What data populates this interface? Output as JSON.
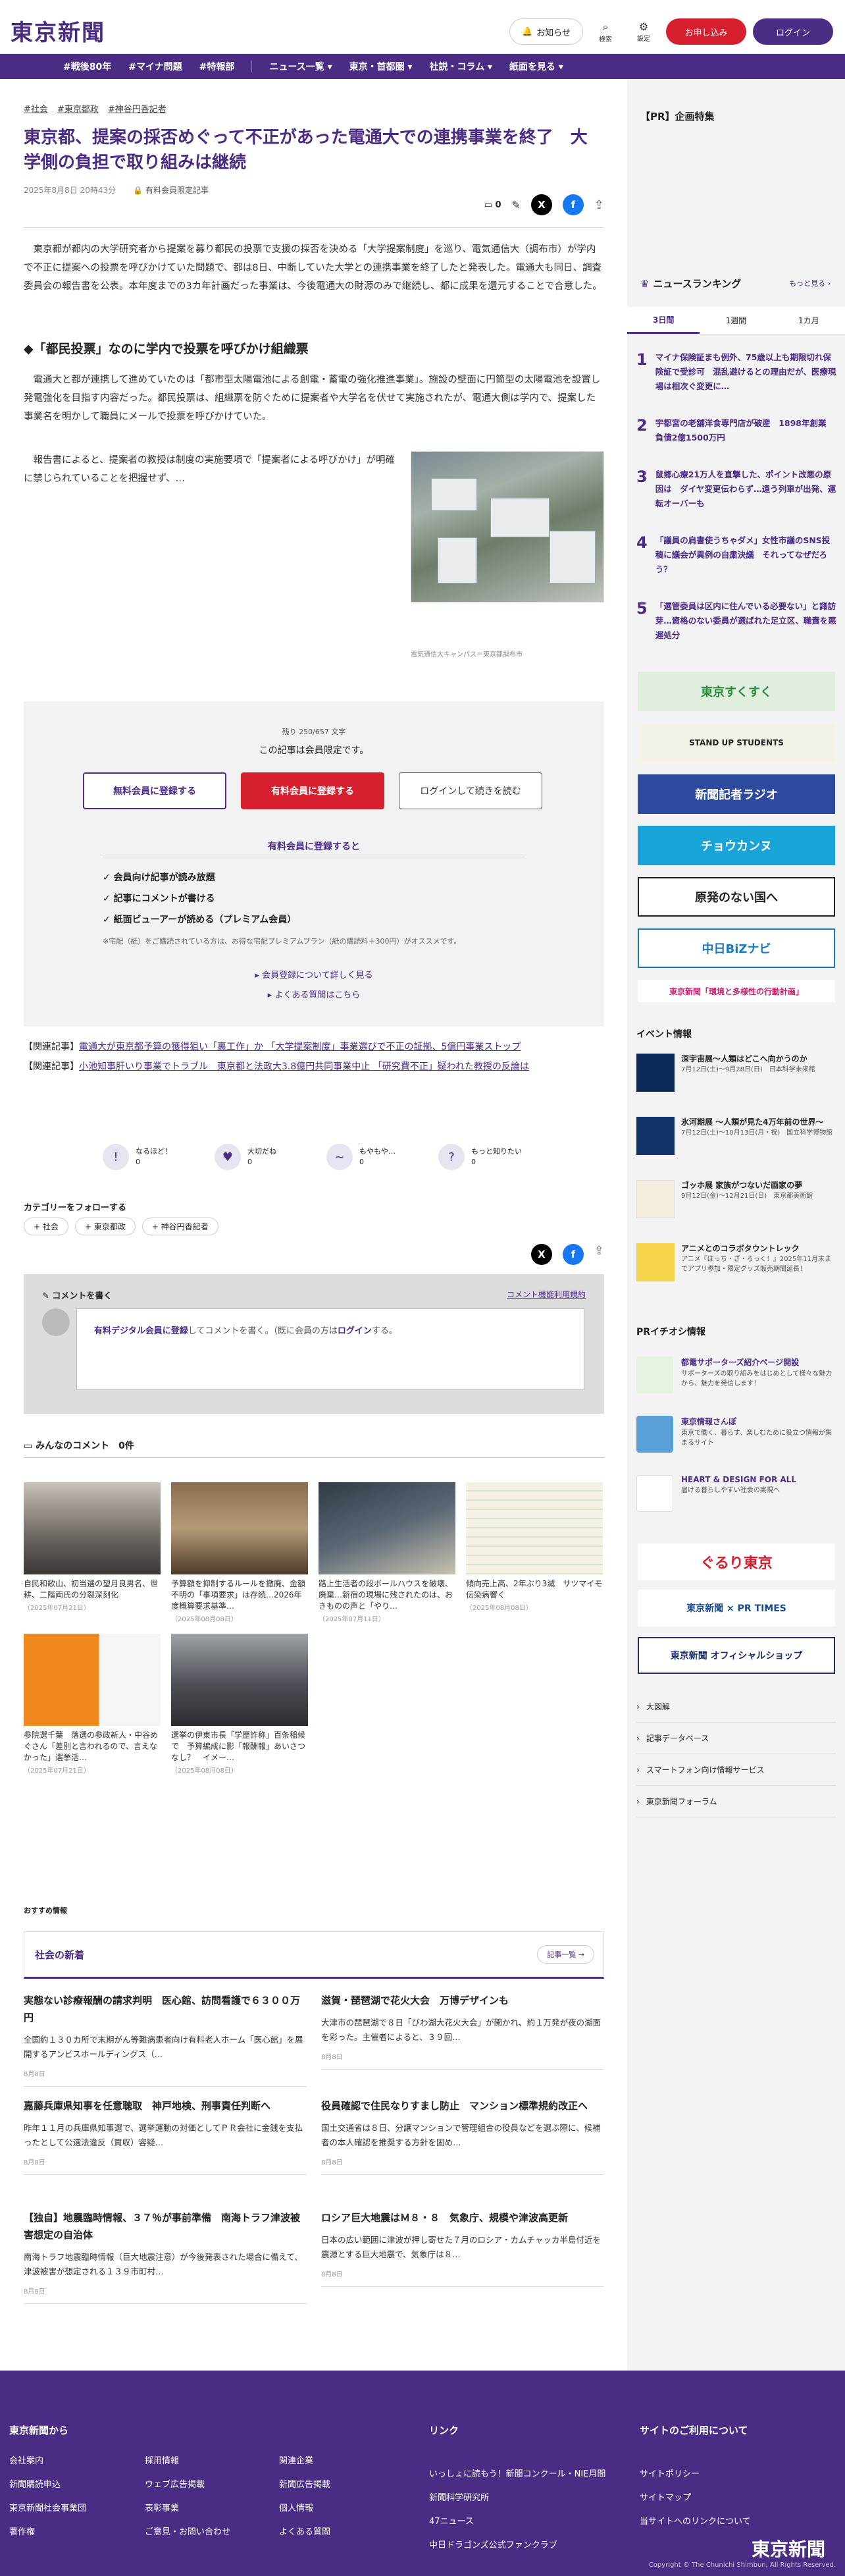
{
  "header": {
    "logo": "東京新聞",
    "notice": "お知らせ",
    "search": "検索",
    "settings": "設定",
    "register": "お申し込み",
    "login": "ログイン"
  },
  "nav": [
    "#戦後80年",
    "#マイナ問題",
    "#特報部",
    "ニュース一覧 ▾",
    "東京・首都圏 ▾",
    "社説・コラム ▾",
    "紙面を見る ▾"
  ],
  "article": {
    "tags": [
      "#社会",
      "#東京都政",
      "#神谷円香記者"
    ],
    "title": "東京都、提案の採否めぐって不正があった電通大での連携事業を終了　大学側の負担で取り組みは継続",
    "date": "2025年8月8日 20時43分",
    "member_label": "有料会員限定記事",
    "comment_count": "0",
    "p1": "東京都が都内の大学研究者から提案を募り都民の投票で支援の採否を決める「大学提案制度」を巡り、電気通信大（調布市）が学内で不正に提案への投票を呼びかけていた問題で、都は8日、中断していた大学との連携事業を終了したと発表した。電通大も同日、調査委員会の報告書を公表。本年度までの3カ年計画だった事業は、今後電通大の財源のみで継続し、都に成果を還元することで合意した。",
    "h2": "◆「都民投票」なのに学内で投票を呼びかけ組織票",
    "p2": "電通大と都が連携して進めていたのは「都市型太陽電池による創電・蓄電の強化推進事業」。施設の壁面に円筒型の太陽電池を設置し発電強化を目指す内容だった。都民投票は、組織票を防ぐために提案者や大学名を伏せて実施されたが、電通大側は学内で、提案した事業名を明かして職員にメールで投票を呼びかけていた。",
    "p3": "報告書によると、提案者の教授は制度の実施要項で「提案者による呼びかけ」が明確に禁じられていることを把握せず、…",
    "caption": "電気通信大キャンパス＝東京都調布市"
  },
  "paywall": {
    "remain": "残り 250/657 文字",
    "msg": "この記事は会員限定です。",
    "free_btn": "無料会員に登録する",
    "paid_btn": "有料会員に登録する",
    "login_btn": "ログインして続きを読む",
    "sub": "有料会員に登録すると",
    "benefits": [
      "✓ 会員向け記事が読み放題",
      "✓ 記事にコメントが書ける",
      "✓ 紙面ビューアーが読める（プレミアム会員）"
    ],
    "note": "※宅配（紙）をご購読されている方は、お得な宅配プレミアムプラン（紙の購読料＋300円）がオススメです。",
    "more1": "▸ 会員登録について詳しく見る",
    "more2": "▸ よくある質問はこちら"
  },
  "related": [
    {
      "label": "【関連記事】",
      "link": "電通大が東京都予算の獲得狙い「裏工作」か 「大学提案制度」事業選びで不正の証拠、5億円事業ストップ"
    },
    {
      "label": "【関連記事】",
      "link": "小池知事肝いり事業でトラブル　東京都と法政大3.8億円共同事業中止 「研究費不正」疑われた教授の反論は"
    }
  ],
  "reactions": [
    {
      "label": "なるほど！",
      "count": "0",
      "icon": "!"
    },
    {
      "label": "大切だね",
      "count": "0",
      "icon": "♥"
    },
    {
      "label": "もやもや…",
      "count": "0",
      "icon": "~"
    },
    {
      "label": "もっと知りたい",
      "count": "0",
      "icon": "?"
    }
  ],
  "follow": {
    "heading": "カテゴリーをフォローする",
    "tags": [
      "+ 社会",
      "+ 東京都政",
      "+ 神谷円香記者"
    ]
  },
  "comment_box": {
    "heading": "コメントを書く",
    "terms": "コメント機能利用規約",
    "prompt_link": "有料デジタル会員に登録",
    "prompt_mid": "してコメントを書く。（既に会員の方は",
    "prompt_login": "ログイン",
    "prompt_end": "する。"
  },
  "all_comments": "みんなのコメント　0件",
  "thumbs": [
    {
      "title": "自民和歌山、初当選の望月良男名、世耕、二階両氏の分裂深刻化",
      "date": "（2025年07月21日）"
    },
    {
      "title": "予算額を抑制するルールを撤廃、金額不明の「事項要求」は存続…2026年度概算要求基準…",
      "date": "（2025年08月08日）"
    },
    {
      "title": "路上生活者の段ボールハウスを破壊、廃棄…新宿の現場に残されたのは、おきものの声と「やり…",
      "date": "（2025年07月11日）"
    },
    {
      "title": "傾向売上高、2年ぶり3減　サツマイモ伝染病響く",
      "date": "（2025年08月08日）"
    },
    {
      "title": "参院選千葉　落選の参政新人・中谷めぐさん「差別と言われるので、言えなかった」選挙活…",
      "date": "（2025年07月21日）"
    },
    {
      "title": "選挙の伊東市長「学歴詐称」百条稲候で　予算編成に影「報酬報」あいさつなし？　イメー…",
      "date": "（2025年08月08日）"
    }
  ],
  "osusume": "おすすめ情報",
  "social_news": {
    "heading": "社会の新着",
    "more": "記事一覧 →",
    "items": [
      {
        "title": "実態ない診療報酬の請求判明　医心館、訪問看護で６３００万円",
        "body": "全国約１３０カ所で末期がん等難病患者向け有料老人ホーム「医心館」を展開するアンビスホールディングス（…",
        "date": "8月8日"
      },
      {
        "title": "滋賀・琵琶湖で花火大会　万博デザインも",
        "body": "大津市の琵琶湖で８日「びわ湖大花火大会」が開かれ、約１万発が夜の湖面を彩った。主催者によると、３９回…",
        "date": "8月8日"
      },
      {
        "title": "嘉藤兵庫県知事を任意聴取　神戸地検、刑事責任判断へ",
        "body": "昨年１１月の兵庫県知事選で、選挙運動の対価としてＰＲ会社に金銭を支払ったとして公選法違反（買収）容疑…",
        "date": "8月8日"
      },
      {
        "title": "役員確認で住民なりすまし防止　マンション標準規約改正へ",
        "body": "国土交通省は８日、分譲マンションで管理組合の役員などを選ぶ際に、候補者の本人確認を推奨する方針を固め…",
        "date": "8月8日"
      },
      {
        "title": "【独自】地震臨時情報、３７％が事前準備　南海トラフ津波被害想定の自治体",
        "body": "南海トラフ地震臨時情報（巨大地震注意）が今後発表された場合に備えて、津波被害が想定される１３９市町村…",
        "date": "8月8日"
      },
      {
        "title": "ロシア巨大地震はＭ８・８　気象庁、規模や津波高更新",
        "body": "日本の広い範囲に津波が押し寄せた７月のロシア・カムチャッカ半島付近を震源とする巨大地震で、気象庁は８…",
        "date": "8月8日"
      }
    ]
  },
  "sidebar": {
    "pr": "【PR】企画特集",
    "ranking_heading": "ニュースランキング",
    "ranking_more": "もっと見る ›",
    "tabs": [
      "3日間",
      "1週間",
      "1カ月"
    ],
    "ranking": [
      {
        "n": "1",
        "t": "マイナ保険証まも例外、75歳以上も期限切れ保険証で受診可　混乱避けるとの理由だが、医療現場は相次ぐ変更に…"
      },
      {
        "n": "2",
        "t": "宇都宮の老舗洋食専門店が破産　1898年創業　負債2億1500万円"
      },
      {
        "n": "3",
        "t": "鼠郷心療21万人を直撃した、ポイント改悪の原因は　ダイヤ変更伝わらず…遠う列車が出発、運転オーバーも"
      },
      {
        "n": "4",
        "t": "「議員の肩書使うちゃダメ」女性市議のSNS投稿に議会が異例の自粛決議　それってなぜだろう？"
      },
      {
        "n": "5",
        "t": "「選管委員は区内に住んでいる必要ない」と諏訪芽…資格のない委員が選ばれた足立区、職責を悪遅処分"
      }
    ],
    "banners": [
      "東京すくすく",
      "STAND UP STUDENTS",
      "新聞記者ラジオ",
      "チョウカンヌ",
      "原発のない国へ",
      "中日BiZナビ",
      "東京新聞「環境と多様性の行動計画」"
    ],
    "events_heading": "イベント情報",
    "events": [
      {
        "t": "深宇宙展〜人類はどこへ向かうのか",
        "s": "7月12日(土)〜9月28日(日)　日本科学未来館"
      },
      {
        "t": "氷河期展 〜人類が見た4万年前の世界〜",
        "s": "7月12日(土)〜10月13日(月・祝)　国立科学博物館"
      },
      {
        "t": "ゴッホ展 家族がつないだ画家の夢",
        "s": "9月12日(金)〜12月21日(日)　東京都美術館"
      },
      {
        "t": "アニメとのコラボタウントレック",
        "s": "アニメ『ぼっち・ざ・ろっく！』2025年11月末までアプリ参加・限定グッズ販売期間延長！"
      }
    ],
    "pr2_heading": "PRイチオシ情報",
    "pr2": [
      {
        "t": "都電サポーターズ紹介ページ開設",
        "s": "サポーターズの取り組みをはじめとして様々な魅力から、魅力を発信します！"
      },
      {
        "t": "東京情報さんぽ",
        "s": "東京で働く、暮らす、楽しむために役立つ情報が集まるサイト"
      },
      {
        "t": "HEART & DESIGN FOR ALL",
        "s": "届ける暮らしやすい社会の実現へ"
      }
    ],
    "banners2": [
      "ぐるり東京",
      "東京新聞 × PR TIMES",
      "東京新聞 オフィシャルショップ"
    ],
    "links": [
      "大図解",
      "記事データベース",
      "スマートフォン向け情報サービス",
      "東京新聞フォーラム"
    ]
  },
  "footer": {
    "col1_h": "東京新聞から",
    "col1": [
      "会社案内",
      "新聞購読申込",
      "東京新聞社会事業団",
      "著作権"
    ],
    "col2": [
      "採用情報",
      "ウェブ広告掲載",
      "表彰事業",
      "ご意見・お問い合わせ"
    ],
    "col3": [
      "関連企業",
      "新聞広告掲載",
      "個人情報",
      "よくある質問"
    ],
    "col4_h": "リンク",
    "col4": [
      "いっしょに読もう！新聞コンクール・NIE月間",
      "新聞科学研究所",
      "47ニュース",
      "中日ドラゴンズ公式ファンクラブ"
    ],
    "col5_h": "サイトのご利用について",
    "col5": [
      "サイトポリシー",
      "サイトマップ",
      "当サイトへのリンクについて"
    ],
    "logo": "東京新聞",
    "copyright": "Copyright © The Chunichi Shimbun, All Rights Reserved."
  }
}
